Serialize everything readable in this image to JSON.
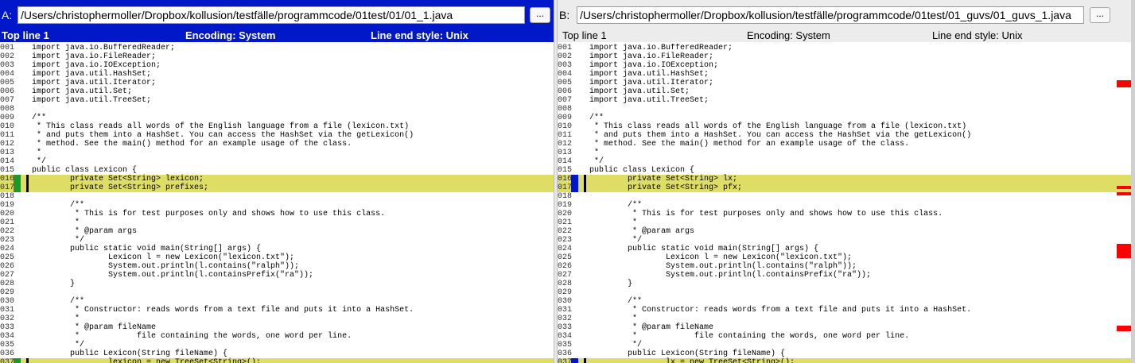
{
  "pane_a": {
    "label": "A:",
    "path": "/Users/christophermoller/Dropbox/kollusion/testfälle/programmcode/01test/01/01_1.java",
    "browse_label": "...",
    "status": {
      "top_line": "Top line 1",
      "encoding": "Encoding: System",
      "line_end": "Line end style: Unix"
    },
    "lines": [
      {
        "n": "001",
        "t": "import java.io.BufferedReader;",
        "c": false
      },
      {
        "n": "002",
        "t": "import java.io.FileReader;",
        "c": false
      },
      {
        "n": "003",
        "t": "import java.io.IOException;",
        "c": false
      },
      {
        "n": "004",
        "t": "import java.util.HashSet;",
        "c": false
      },
      {
        "n": "005",
        "t": "import java.util.Iterator;",
        "c": false
      },
      {
        "n": "006",
        "t": "import java.util.Set;",
        "c": false
      },
      {
        "n": "007",
        "t": "import java.util.TreeSet;",
        "c": false
      },
      {
        "n": "008",
        "t": "",
        "c": false
      },
      {
        "n": "009",
        "t": "/**",
        "c": false
      },
      {
        "n": "010",
        "t": " * This class reads all words of the English language from a file (lexicon.txt)",
        "c": false
      },
      {
        "n": "011",
        "t": " * and puts them into a HashSet. You can access the HashSet via the getLexicon()",
        "c": false
      },
      {
        "n": "012",
        "t": " * method. See the main() method for an example usage of the class.",
        "c": false
      },
      {
        "n": "013",
        "t": " *",
        "c": false
      },
      {
        "n": "014",
        "t": " */",
        "c": false
      },
      {
        "n": "015",
        "t": "public class Lexicon {",
        "c": false
      },
      {
        "n": "016",
        "t": "        private Set<String> lexicon;",
        "c": true
      },
      {
        "n": "017",
        "t": "        private Set<String> prefixes;",
        "c": true
      },
      {
        "n": "018",
        "t": "",
        "c": false
      },
      {
        "n": "019",
        "t": "        /**",
        "c": false
      },
      {
        "n": "020",
        "t": "         * This is for test purposes only and shows how to use this class.",
        "c": false
      },
      {
        "n": "021",
        "t": "         *",
        "c": false
      },
      {
        "n": "022",
        "t": "         * @param args",
        "c": false
      },
      {
        "n": "023",
        "t": "         */",
        "c": false
      },
      {
        "n": "024",
        "t": "        public static void main(String[] args) {",
        "c": false
      },
      {
        "n": "025",
        "t": "                Lexicon l = new Lexicon(\"lexicon.txt\");",
        "c": false
      },
      {
        "n": "026",
        "t": "                System.out.println(l.contains(\"ralph\"));",
        "c": false
      },
      {
        "n": "027",
        "t": "                System.out.println(l.containsPrefix(\"ra\"));",
        "c": false
      },
      {
        "n": "028",
        "t": "        }",
        "c": false
      },
      {
        "n": "029",
        "t": "",
        "c": false
      },
      {
        "n": "030",
        "t": "        /**",
        "c": false
      },
      {
        "n": "031",
        "t": "         * Constructor: reads words from a text file and puts it into a HashSet.",
        "c": false
      },
      {
        "n": "032",
        "t": "         *",
        "c": false
      },
      {
        "n": "033",
        "t": "         * @param fileName",
        "c": false
      },
      {
        "n": "034",
        "t": "         *            file containing the words, one word per line.",
        "c": false
      },
      {
        "n": "035",
        "t": "         */",
        "c": false
      },
      {
        "n": "036",
        "t": "        public Lexicon(String fileName) {",
        "c": false
      },
      {
        "n": "037",
        "t": "                lexicon = new TreeSet<String>();",
        "c": true
      }
    ]
  },
  "pane_b": {
    "label": "B:",
    "path": "/Users/christophermoller/Dropbox/kollusion/testfälle/programmcode/01test/01_guvs/01_guvs_1.java",
    "browse_label": "...",
    "status": {
      "top_line": "Top line 1",
      "encoding": "Encoding: System",
      "line_end": "Line end style: Unix"
    },
    "lines": [
      {
        "n": "001",
        "t": "import java.io.BufferedReader;",
        "c": false
      },
      {
        "n": "002",
        "t": "import java.io.FileReader;",
        "c": false
      },
      {
        "n": "003",
        "t": "import java.io.IOException;",
        "c": false
      },
      {
        "n": "004",
        "t": "import java.util.HashSet;",
        "c": false
      },
      {
        "n": "005",
        "t": "import java.util.Iterator;",
        "c": false
      },
      {
        "n": "006",
        "t": "import java.util.Set;",
        "c": false
      },
      {
        "n": "007",
        "t": "import java.util.TreeSet;",
        "c": false
      },
      {
        "n": "008",
        "t": "",
        "c": false
      },
      {
        "n": "009",
        "t": "/**",
        "c": false
      },
      {
        "n": "010",
        "t": " * This class reads all words of the English language from a file (lexicon.txt)",
        "c": false
      },
      {
        "n": "011",
        "t": " * and puts them into a HashSet. You can access the HashSet via the getLexicon()",
        "c": false
      },
      {
        "n": "012",
        "t": " * method. See the main() method for an example usage of the class.",
        "c": false
      },
      {
        "n": "013",
        "t": " *",
        "c": false
      },
      {
        "n": "014",
        "t": " */",
        "c": false
      },
      {
        "n": "015",
        "t": "public class Lexicon {",
        "c": false
      },
      {
        "n": "016",
        "t": "        private Set<String> lx;",
        "c": true
      },
      {
        "n": "017",
        "t": "        private Set<String> pfx;",
        "c": true
      },
      {
        "n": "018",
        "t": "",
        "c": false
      },
      {
        "n": "019",
        "t": "        /**",
        "c": false
      },
      {
        "n": "020",
        "t": "         * This is for test purposes only and shows how to use this class.",
        "c": false
      },
      {
        "n": "021",
        "t": "         *",
        "c": false
      },
      {
        "n": "022",
        "t": "         * @param args",
        "c": false
      },
      {
        "n": "023",
        "t": "         */",
        "c": false
      },
      {
        "n": "024",
        "t": "        public static void main(String[] args) {",
        "c": false
      },
      {
        "n": "025",
        "t": "                Lexicon l = new Lexicon(\"lexicon.txt\");",
        "c": false
      },
      {
        "n": "026",
        "t": "                System.out.println(l.contains(\"ralph\"));",
        "c": false
      },
      {
        "n": "027",
        "t": "                System.out.println(l.containsPrefix(\"ra\"));",
        "c": false
      },
      {
        "n": "028",
        "t": "        }",
        "c": false
      },
      {
        "n": "029",
        "t": "",
        "c": false
      },
      {
        "n": "030",
        "t": "        /**",
        "c": false
      },
      {
        "n": "031",
        "t": "         * Constructor: reads words from a text file and puts it into a HashSet.",
        "c": false
      },
      {
        "n": "032",
        "t": "         *",
        "c": false
      },
      {
        "n": "033",
        "t": "         * @param fileName",
        "c": false
      },
      {
        "n": "034",
        "t": "         *            file containing the words, one word per line.",
        "c": false
      },
      {
        "n": "035",
        "t": "         */",
        "c": false
      },
      {
        "n": "036",
        "t": "        public Lexicon(String fileName) {",
        "c": false
      },
      {
        "n": "037",
        "t": "                lx = new TreeSet<String>();",
        "c": true
      }
    ]
  },
  "colors": {
    "active_header": "#0018c8",
    "changed_line": "#dedd66",
    "marker_a": "#1a9a2a",
    "marker_b": "#0018c8",
    "overview_mark": "#ff0000"
  }
}
